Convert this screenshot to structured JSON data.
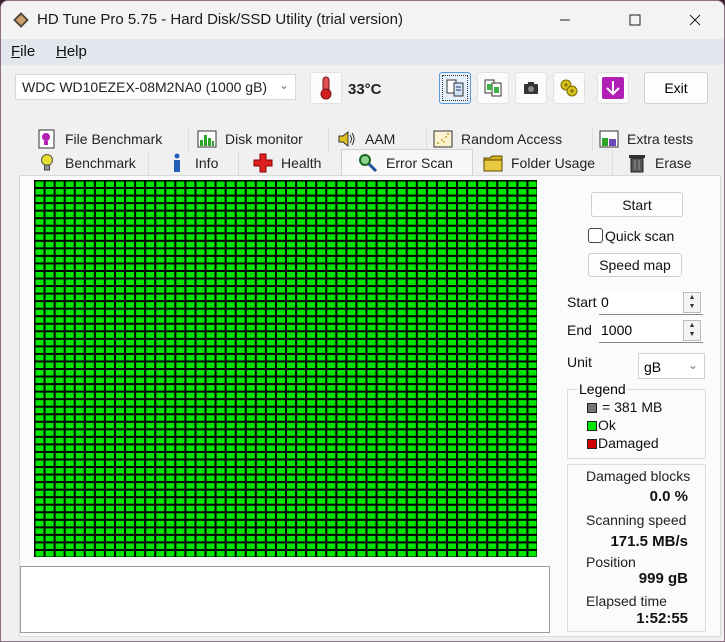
{
  "window": {
    "title": "HD Tune Pro 5.75 - Hard Disk/SSD Utility (trial version)",
    "controls": {
      "minimize": "—",
      "maximize": "☐",
      "close": "✕"
    }
  },
  "menu": {
    "items": [
      {
        "label": "File",
        "accel": "F",
        "rest": "ile"
      },
      {
        "label": "Help",
        "accel": "H",
        "rest": "elp"
      }
    ]
  },
  "toolbar": {
    "drive": "WDC WD10EZEX-08M2NA0 (1000 gB)",
    "temperature": "33°C",
    "buttons": [
      {
        "name": "copy-text-icon"
      },
      {
        "name": "copy-screenshot-icon"
      },
      {
        "name": "camera-icon"
      },
      {
        "name": "options-gears-icon"
      },
      {
        "name": "download-arrow-icon"
      }
    ],
    "exit_label": "Exit"
  },
  "tabs": {
    "row1": [
      {
        "label": "File Benchmark",
        "icon": "file-benchmark-icon"
      },
      {
        "label": "Disk monitor",
        "icon": "disk-monitor-icon"
      },
      {
        "label": "AAM",
        "icon": "speaker-icon"
      },
      {
        "label": "Random Access",
        "icon": "random-access-icon"
      },
      {
        "label": "Extra tests",
        "icon": "extra-tests-icon"
      }
    ],
    "row2": [
      {
        "label": "Benchmark",
        "icon": "lightbulb-icon"
      },
      {
        "label": "Info",
        "icon": "info-icon"
      },
      {
        "label": "Health",
        "icon": "health-cross-icon"
      },
      {
        "label": "Error Scan",
        "icon": "magnifier-icon",
        "selected": true
      },
      {
        "label": "Folder Usage",
        "icon": "folder-icon"
      },
      {
        "label": "Erase",
        "icon": "trash-icon"
      }
    ]
  },
  "scan": {
    "grid": {
      "cols": 50,
      "rows": 50,
      "status": "ok",
      "ok_color": "#00e600",
      "border_color": "#000000"
    },
    "start_button": "Start",
    "quick_scan_label": "Quick scan",
    "quick_scan_checked": false,
    "speed_map_button": "Speed map",
    "start_label": "Start",
    "start_value": "0",
    "end_label": "End",
    "end_value": "1000",
    "unit_label": "Unit",
    "unit_value": "gB",
    "legend": {
      "title": "Legend",
      "items": [
        {
          "label": "= 381 MB",
          "color": "#7a7a7a"
        },
        {
          "label": "Ok",
          "color": "#00e600"
        },
        {
          "label": "Damaged",
          "color": "#d00000"
        }
      ]
    },
    "stats": [
      {
        "label": "Damaged blocks",
        "value": "0.0 %"
      },
      {
        "label": "Scanning speed",
        "value": "171.5 MB/s"
      },
      {
        "label": "Position",
        "value": "999 gB"
      },
      {
        "label": "Elapsed time",
        "value": "1:52:55"
      }
    ]
  }
}
